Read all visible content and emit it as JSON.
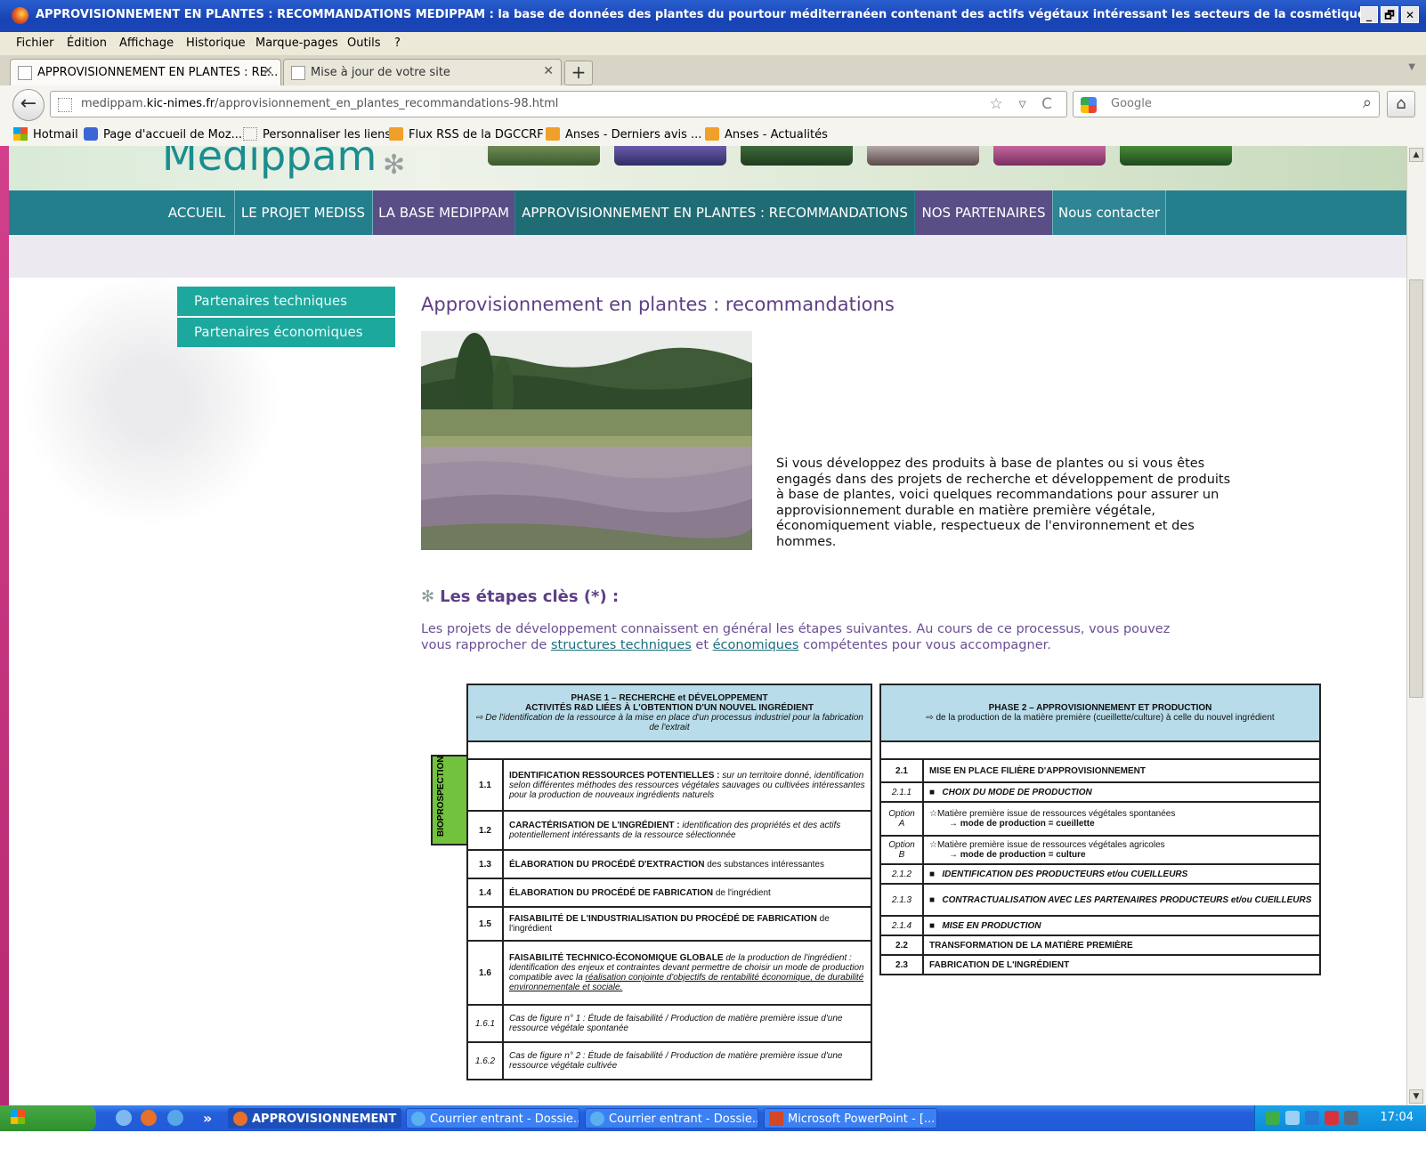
{
  "window": {
    "title": "APPROVISIONNEMENT EN PLANTES : RECOMMANDATIONS  MEDIPPAM : la base de données des plantes du pourtour méditerranéen contenant des actifs végétaux intéressant les secteurs de la cosmétique et de des ...",
    "controls": [
      "_",
      "🗗",
      "✕"
    ]
  },
  "menu": [
    "Fichier",
    "Édition",
    "Affichage",
    "Historique",
    "Marque-pages",
    "Outils",
    "?"
  ],
  "tabs": [
    {
      "label": "APPROVISIONNEMENT EN PLANTES : RE...",
      "close": "✕"
    },
    {
      "label": "Mise à jour de votre site",
      "close": "✕"
    }
  ],
  "new_tab": "+",
  "address": {
    "prefix": "medippam.",
    "domain": "kic-nimes.fr",
    "path": "/approvisionnement_en_plantes_recommandations-98.html",
    "icons": "☆ ▿ C"
  },
  "search": {
    "placeholder": "Google"
  },
  "bookmarks": [
    "Hotmail",
    "Page d'accueil de Moz...",
    "Personnaliser les liens",
    "Flux RSS de la DGCCRF",
    "Anses - Derniers avis ...",
    "Anses - Actualités"
  ],
  "site": {
    "logo": "Medippam",
    "nav": [
      "ACCUEIL",
      "LE PROJET MEDISS",
      "LA BASE MEDIPPAM",
      "APPROVISIONNEMENT EN PLANTES : RECOMMANDATIONS",
      "NOS PARTENAIRES",
      "Nous contacter"
    ],
    "nav_active_index": 3,
    "sidebar": [
      "Partenaires techniques",
      "Partenaires économiques"
    ]
  },
  "content": {
    "title": "Approvisionnement en plantes : recommandations",
    "intro": "Si vous développez des produits à base de plantes ou si vous êtes engagés dans des projets de recherche et développement de produits à base de plantes, voici quelques recommandations pour assurer un approvisionnement durable en matière première végétale, économiquement viable, respectueux de l'environnement et des hommes.",
    "steps_title": "Les étapes clès (*) :",
    "steps_desc_1": "Les projets de développement connaissent en général les étapes suivantes. Au cours de ce processus, vous pouvez vous rapprocher de ",
    "link_tech": "structures techniques",
    "steps_desc_2": " et ",
    "link_eco": "économiques",
    "steps_desc_3": " compétentes pour vous accompagner."
  },
  "phase1": {
    "title": "PHASE 1 – RECHERCHE et DÉVELOPPEMENT",
    "subtitle": "ACTIVITÉS R&D LIÉES À L'OBTENTION D'UN NOUVEL INGRÉDIENT",
    "note": "⇨ De l'identification de la ressource à la mise en place d'un processus industriel pour la fabrication de l'extrait",
    "side_label": "BIOPROSPECTION",
    "rows": [
      {
        "num": "1.1",
        "bold": "IDENTIFICATION RESSOURCES POTENTIELLES :",
        "rest": " sur un territoire donné, identification selon différentes méthodes des ressources végétales sauvages ou cultivées intéressantes pour la production de nouveaux ingrédients naturels"
      },
      {
        "num": "1.2",
        "bold": "CARACTÉRISATION DE L'INGRÉDIENT :",
        "rest": " identification des propriétés et des actifs potentiellement intéressants de la ressource sélectionnée"
      },
      {
        "num": "1.3",
        "bold": "ÉLABORATION DU PROCÉDÉ D'EXTRACTION",
        "rest": " des substances intéressantes"
      },
      {
        "num": "1.4",
        "bold": "ÉLABORATION DU PROCÉDÉ DE FABRICATION",
        "rest": " de l'ingrédient"
      },
      {
        "num": "1.5",
        "bold": "FAISABILITÉ DE L'INDUSTRIALISATION DU PROCÉDÉ DE FABRICATION",
        "rest": " de l'ingrédient"
      },
      {
        "num": "1.6",
        "bold": "FAISABILITÉ TECHNICO-ÉCONOMIQUE GLOBALE",
        "rest": " de la production de l'ingrédient : identification des enjeux et contraintes devant permettre de choisir un mode de production compatible avec la ",
        "under": "réalisation conjointe d'objectifs de rentabilité économique, de durabilité environnementale et sociale."
      },
      {
        "num": "1.6.1",
        "text": "Cas de figure n° 1 : Étude de faisabilité / Production de matière première issue d'une ressource végétale spontanée"
      },
      {
        "num": "1.6.2",
        "text": "Cas de figure n° 2 : Étude de faisabilité / Production de matière première issue d'une ressource végétale cultivée"
      }
    ]
  },
  "phase2": {
    "title": "PHASE 2 – APPROVISIONNEMENT ET PRODUCTION",
    "note": "⇨ de la production de la matière première (cueillette/culture) à celle du nouvel ingrédient",
    "rows": [
      {
        "num": "2.1",
        "text": "MISE EN PLACE FILIÈRE D'APPROVISIONNEMENT"
      },
      {
        "num": "2.1.1",
        "text": "CHOIX DU MODE DE PRODUCTION"
      },
      {
        "num": "Option A",
        "line1": "☆Matière première issue de ressources végétales spontanées",
        "line2": "→ mode de production  = cueillette"
      },
      {
        "num": "Option B",
        "line1": "☆Matière première issue de ressources végétales agricoles",
        "line2": "→ mode de production = culture"
      },
      {
        "num": "2.1.2",
        "text": "IDENTIFICATION DES PRODUCTEURS et/ou CUEILLEURS"
      },
      {
        "num": "2.1.3",
        "text": "CONTRACTUALISATION AVEC LES PARTENAIRES PRODUCTEURS et/ou CUEILLEURS"
      },
      {
        "num": "2.1.4",
        "text": "MISE EN PRODUCTION"
      },
      {
        "num": "2.2",
        "text": "TRANSFORMATION DE LA MATIÈRE PREMIÈRE"
      },
      {
        "num": "2.3",
        "text": "FABRICATION DE L'INGRÉDIENT"
      }
    ]
  },
  "taskbar": {
    "start": "Démarrer",
    "more": "»",
    "items": [
      "APPROVISIONNEMENT ...",
      "Courrier entrant - Dossie...",
      "Courrier entrant - Dossie...",
      "Microsoft PowerPoint - [..."
    ],
    "clock": "17:04"
  },
  "colors": {
    "nav_bg": "#247f8d",
    "nav_active": "#1f6c74",
    "nav_purple": "#5a4e87",
    "sidebar_bg": "#1da89e",
    "title_color": "#5e3f86",
    "table_header": "#b8dce9",
    "bioprospection": "#73c23d"
  }
}
